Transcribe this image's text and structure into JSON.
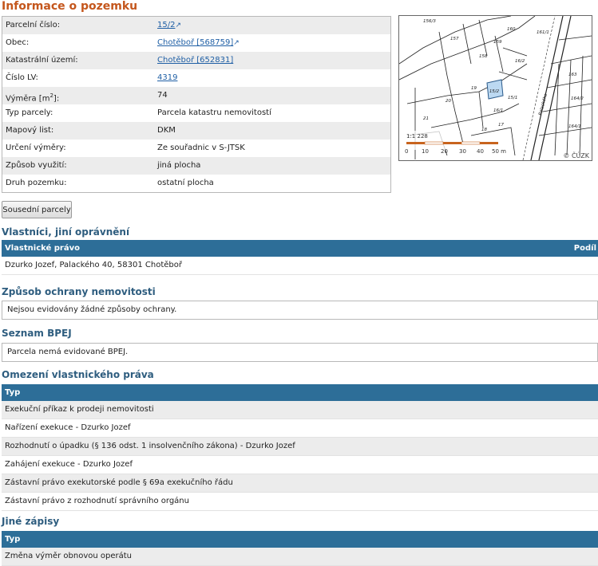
{
  "title": "Informace o pozemku",
  "info_rows": [
    {
      "label": "Parcelní číslo:",
      "value": "15/2",
      "link": true,
      "ext": true
    },
    {
      "label": "Obec:",
      "value": "Chotěboř [568759]",
      "link": true,
      "ext": true
    },
    {
      "label": "Katastrální území:",
      "value": "Chotěboř [652831]",
      "link": true,
      "ext": false
    },
    {
      "label": "Číslo LV:",
      "value": "4319",
      "link": true,
      "ext": false
    },
    {
      "label": "Výměra [m",
      "sup": "2",
      "label_end": "]:",
      "value": "74"
    },
    {
      "label": "Typ parcely:",
      "value": "Parcela katastru nemovitostí"
    },
    {
      "label": "Mapový list:",
      "value": "DKM"
    },
    {
      "label": "Určení výměry:",
      "value": "Ze souřadnic v S-JTSK"
    },
    {
      "label": "Způsob využití:",
      "value": "jiná plocha"
    },
    {
      "label": "Druh pozemku:",
      "value": "ostatní plocha"
    }
  ],
  "ext_icon": "↗",
  "map": {
    "scale": "1:1 228",
    "scalebar_labels": [
      "0",
      "10",
      "20",
      "30",
      "40",
      "50 m"
    ],
    "copyright": "© ČÚZK",
    "street": "Palackého",
    "parcel_labels": [
      "15/1",
      "15/2",
      "16/1",
      "16/2",
      "17",
      "18",
      "19",
      "20",
      "21",
      "156/3",
      "157",
      "158",
      "159",
      "160",
      "161/1",
      "163",
      "164/1",
      "164/2"
    ]
  },
  "neighbors_button": "Sousední parcely",
  "owners": {
    "title": "Vlastníci, jiní oprávnění",
    "col1": "Vlastnické právo",
    "col2": "Podíl",
    "rows": [
      "Dzurko Jozef, Palackého 40, 58301 Chotěboř"
    ]
  },
  "protection": {
    "title": "Způsob ochrany nemovitosti",
    "text": "Nejsou evidovány žádné způsoby ochrany."
  },
  "bpej": {
    "title": "Seznam BPEJ",
    "text": "Parcela nemá evidované BPEJ."
  },
  "restrictions": {
    "title": "Omezení vlastnického práva",
    "col1": "Typ",
    "rows": [
      "Exekuční příkaz k prodeji nemovitosti",
      "Nařízení exekuce - Dzurko Jozef",
      "Rozhodnutí o úpadku (§ 136 odst. 1 insolvenčního zákona) - Dzurko Jozef",
      "Zahájení exekuce - Dzurko Jozef",
      "Zástavní právo exekutorské podle § 69a exekučního řádu",
      "Zástavní právo z rozhodnutí správního orgánu"
    ]
  },
  "other": {
    "title": "Jiné zápisy",
    "col1": "Typ",
    "rows": [
      "Změna výměr obnovou operátu"
    ]
  },
  "colors": {
    "title": "#c4561c",
    "section": "#2e5d7f",
    "header_bg": "#2d6e98",
    "link": "#1f5fa5",
    "highlight": "#bcd9f2"
  }
}
